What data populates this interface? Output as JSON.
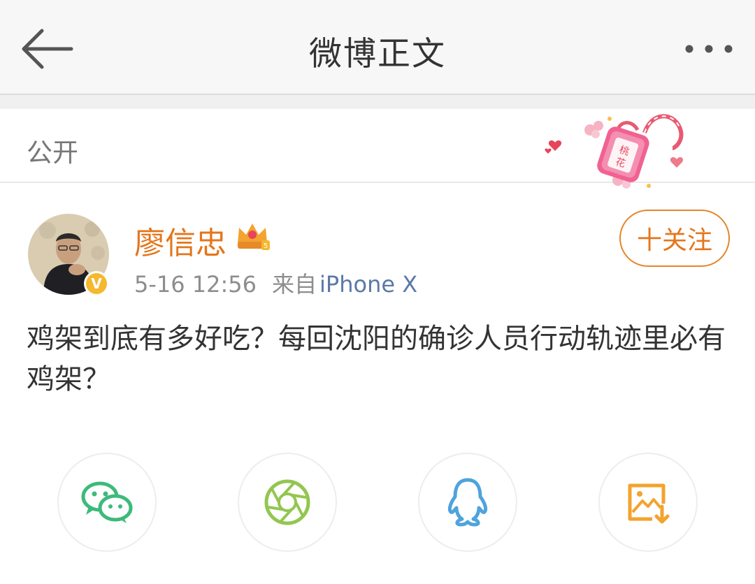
{
  "header": {
    "title": "微博正文",
    "back_icon": "back-arrow-icon",
    "more_icon": "more-dots-icon"
  },
  "visibility": {
    "label": "公开",
    "sticker_text": "桃花"
  },
  "post": {
    "author": "廖信忠",
    "verified_badge": "V",
    "timestamp": "5-16 12:56",
    "source_prefix": "来自",
    "source_device": "iPhone X",
    "follow_label": "十关注",
    "text": "鸡架到底有多好吃？每回沈阳的确诊人员行动轨迹里必有鸡架？"
  },
  "share": {
    "buttons": [
      {
        "name": "wechat",
        "icon": "wechat-icon",
        "color": "#3dba7a"
      },
      {
        "name": "moments",
        "icon": "moments-aperture-icon",
        "color": "#93c650"
      },
      {
        "name": "qq",
        "icon": "qq-penguin-icon",
        "color": "#4ea3dc"
      },
      {
        "name": "save-image",
        "icon": "save-image-icon",
        "color": "#f3a32e"
      }
    ]
  },
  "colors": {
    "accent_orange": "#e4761b",
    "link_blue": "#5b79a6",
    "text_main": "#333333",
    "text_meta": "#8d8d8d"
  }
}
